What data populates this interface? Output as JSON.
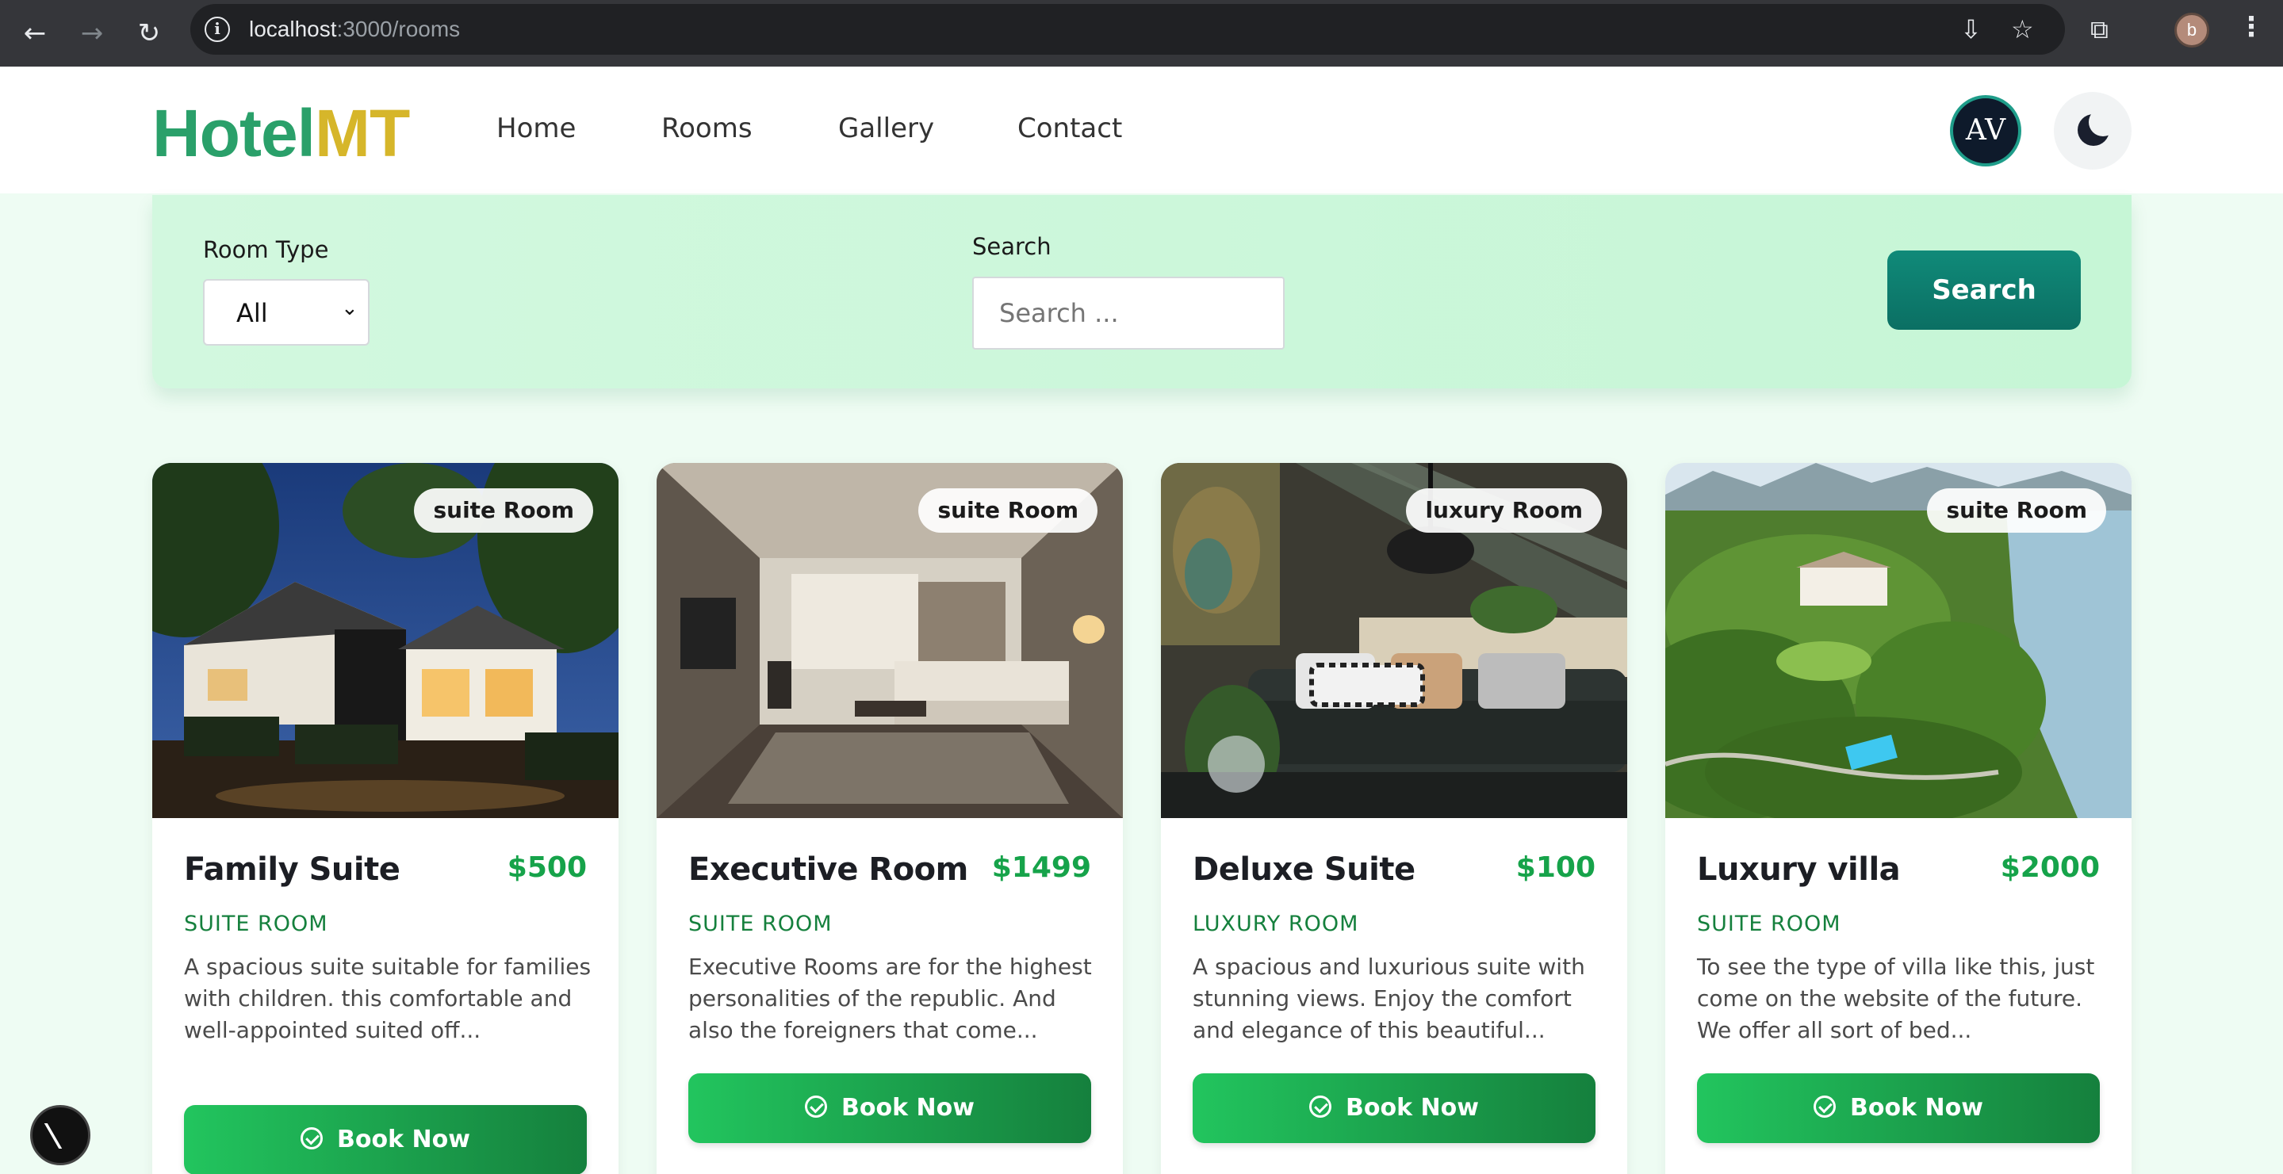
{
  "browser": {
    "url_host": "localhost",
    "url_path": ":3000/rooms",
    "profile_initial": "b"
  },
  "header": {
    "logo_part1": "Hotel",
    "logo_part2": "MT",
    "nav": [
      "Home",
      "Rooms",
      "Gallery",
      "Contact"
    ],
    "avatar_text": "AV"
  },
  "filter": {
    "room_type_label": "Room Type",
    "room_type_value": "All",
    "search_label": "Search",
    "search_placeholder": "Search ...",
    "search_button": "Search"
  },
  "rooms": [
    {
      "badge": "suite Room",
      "name": "Family Suite",
      "price": "$500",
      "type": "SUITE ROOM",
      "description": "A spacious suite suitable for families with children. this comfortable and well-appointed suited off...",
      "cta": "Book Now"
    },
    {
      "badge": "suite Room",
      "name": "Executive Room",
      "price": "$1499",
      "type": "SUITE ROOM",
      "description": "Executive Rooms are for the highest personalities of the republic. And also the foreigners that come...",
      "cta": "Book Now"
    },
    {
      "badge": "luxury Room",
      "name": "Deluxe Suite",
      "price": "$100",
      "type": "LUXURY ROOM",
      "description": "A spacious and luxurious suite with stunning views. Enjoy the comfort and elegance of this beautiful...",
      "cta": "Book Now"
    },
    {
      "badge": "suite Room",
      "name": "Luxury villa",
      "price": "$2000",
      "type": "SUITE ROOM",
      "description": "To see the type of villa like this, just come on the website of the future. We offer all sort of bed...",
      "cta": "Book Now"
    }
  ],
  "colors": {
    "brand_green": "#16a34a",
    "brand_teal": "#0b6f63",
    "logo_green": "#2aa06a",
    "logo_gold": "#d6b62a"
  }
}
